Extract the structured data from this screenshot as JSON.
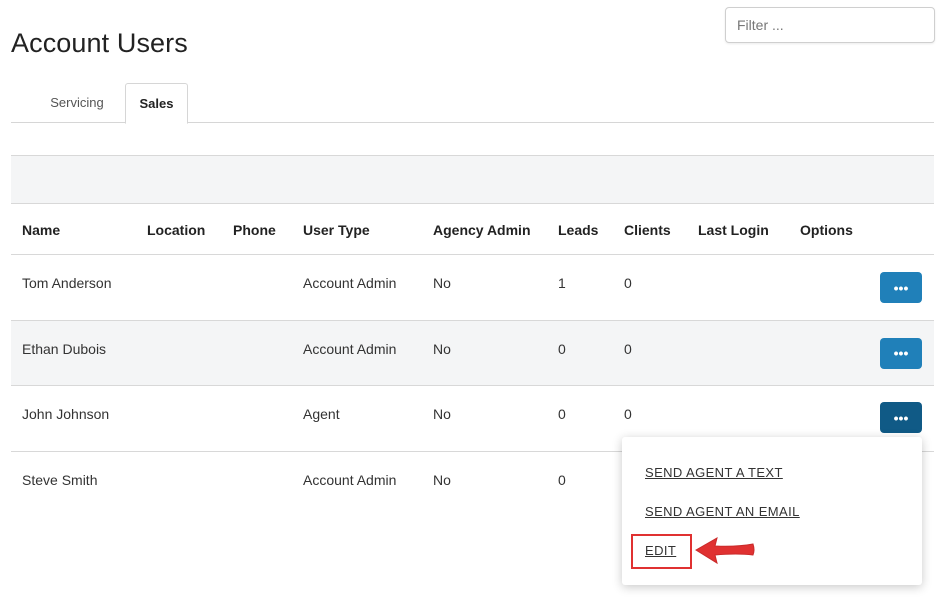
{
  "page": {
    "title": "Account Users"
  },
  "filter": {
    "placeholder": "Filter ..."
  },
  "tabs": [
    {
      "label": "Servicing",
      "active": false
    },
    {
      "label": "Sales",
      "active": true
    }
  ],
  "table": {
    "headers": [
      "Name",
      "Location",
      "Phone",
      "User Type",
      "Agency Admin",
      "Leads",
      "Clients",
      "Last Login",
      "Options"
    ],
    "rows": [
      {
        "name": "Tom Anderson",
        "location": "",
        "phone": "",
        "user_type": "Account Admin",
        "agency_admin": "No",
        "leads": "1",
        "clients": "0",
        "last_login": "",
        "options_label": "•••"
      },
      {
        "name": "Ethan Dubois",
        "location": "",
        "phone": "",
        "user_type": "Account Admin",
        "agency_admin": "No",
        "leads": "0",
        "clients": "0",
        "last_login": "",
        "options_label": "•••"
      },
      {
        "name": "John Johnson",
        "location": "",
        "phone": "",
        "user_type": "Agent",
        "agency_admin": "No",
        "leads": "0",
        "clients": "0",
        "last_login": "",
        "options_label": "•••"
      },
      {
        "name": "Steve Smith",
        "location": "",
        "phone": "",
        "user_type": "Account Admin",
        "agency_admin": "No",
        "leads": "0",
        "clients": "",
        "last_login": "",
        "options_label": ""
      }
    ]
  },
  "options_menu": {
    "items": [
      {
        "label": "SEND AGENT A TEXT"
      },
      {
        "label": "SEND AGENT AN EMAIL"
      },
      {
        "label": "EDIT"
      }
    ]
  },
  "annotation": {
    "highlight_color": "#e03131",
    "arrow_color": "#e03131",
    "arrow_icon": "arrow-left-icon"
  },
  "colors": {
    "button": "#2080b9",
    "button_active": "#105a86",
    "row_alt": "#f4f5f6"
  }
}
